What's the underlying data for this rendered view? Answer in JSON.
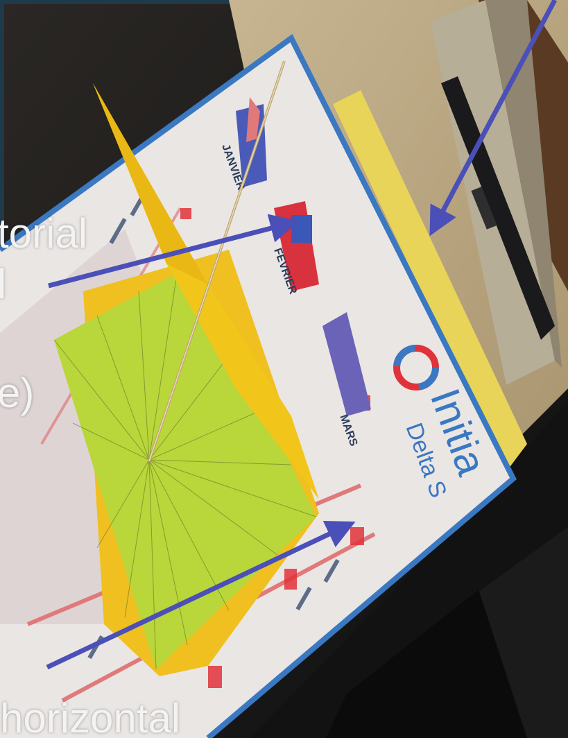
{
  "captions": {
    "line1": "torial",
    "line2": "l",
    "line3": "e)",
    "line4": "horizontal"
  },
  "calendar_text": {
    "months": [
      "JANVIER",
      "FEVRIER",
      "MARS"
    ],
    "brand": "Initia",
    "brand_sub": "Delta S"
  },
  "colors": {
    "frame": "#1f3a4a",
    "arrow": "#4b4fb8",
    "yellow_card": "#f0c020",
    "green_card": "#b9d63a",
    "calendar_border": "#3a78c2",
    "calendar_red": "#e0323a",
    "caption_text": "#f3f3f3"
  }
}
